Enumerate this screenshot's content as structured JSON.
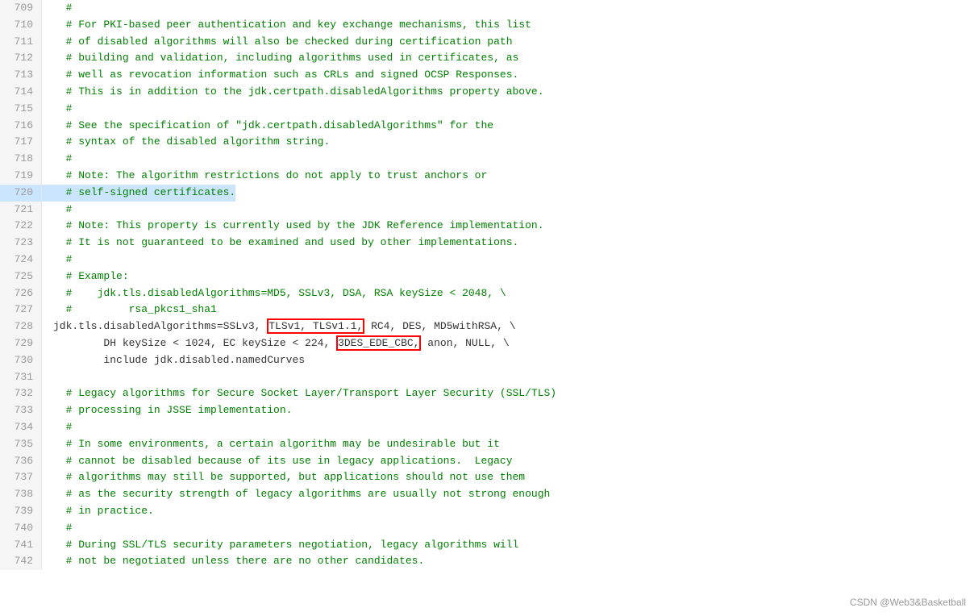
{
  "editor": {
    "background": "#ffffff",
    "lines": [
      {
        "num": 709,
        "text": "  #",
        "comment": true,
        "highlight": false
      },
      {
        "num": 710,
        "text": "  # For PKI-based peer authentication and key exchange mechanisms, this list",
        "comment": true,
        "highlight": false
      },
      {
        "num": 711,
        "text": "  # of disabled algorithms will also be checked during certification path",
        "comment": true,
        "highlight": false
      },
      {
        "num": 712,
        "text": "  # building and validation, including algorithms used in certificates, as",
        "comment": true,
        "highlight": false
      },
      {
        "num": 713,
        "text": "  # well as revocation information such as CRLs and signed OCSP Responses.",
        "comment": true,
        "highlight": false
      },
      {
        "num": 714,
        "text": "  # This is in addition to the jdk.certpath.disabledAlgorithms property above.",
        "comment": true,
        "highlight": false
      },
      {
        "num": 715,
        "text": "  #",
        "comment": true,
        "highlight": false
      },
      {
        "num": 716,
        "text": "  # See the specification of \"jdk.certpath.disabledAlgorithms\" for the",
        "comment": true,
        "highlight": false
      },
      {
        "num": 717,
        "text": "  # syntax of the disabled algorithm string.",
        "comment": true,
        "highlight": false
      },
      {
        "num": 718,
        "text": "  #",
        "comment": true,
        "highlight": false
      },
      {
        "num": 719,
        "text": "  # Note: The algorithm restrictions do not apply to trust anchors or",
        "comment": true,
        "highlight": false
      },
      {
        "num": 720,
        "text": "  # self-signed certificates.",
        "comment": true,
        "highlight": true
      },
      {
        "num": 721,
        "text": "  #",
        "comment": true,
        "highlight": false
      },
      {
        "num": 722,
        "text": "  # Note: This property is currently used by the JDK Reference implementation.",
        "comment": true,
        "highlight": false
      },
      {
        "num": 723,
        "text": "  # It is not guaranteed to be examined and used by other implementations.",
        "comment": true,
        "highlight": false
      },
      {
        "num": 724,
        "text": "  #",
        "comment": true,
        "highlight": false
      },
      {
        "num": 725,
        "text": "  # Example:",
        "comment": true,
        "highlight": false
      },
      {
        "num": 726,
        "text": "  #    jdk.tls.disabledAlgorithms=MD5, SSLv3, DSA, RSA keySize < 2048, \\",
        "comment": true,
        "highlight": false
      },
      {
        "num": 727,
        "text": "  #         rsa_pkcs1_sha1",
        "comment": true,
        "highlight": false
      },
      {
        "num": 728,
        "text": "jdk.tls.disabledAlgorithms=SSLv3, TLSv1, TLSv1.1, RC4, DES, MD5withRSA, \\",
        "comment": false,
        "highlight": false,
        "special728": true
      },
      {
        "num": 729,
        "text": "        DH keySize < 1024, EC keySize < 224, 3DES_EDE_CBC, anon, NULL, \\",
        "comment": false,
        "highlight": false,
        "special729": true
      },
      {
        "num": 730,
        "text": "        include jdk.disabled.namedCurves",
        "comment": false,
        "highlight": false
      },
      {
        "num": 731,
        "text": "",
        "comment": false,
        "highlight": false
      },
      {
        "num": 732,
        "text": "  # Legacy algorithms for Secure Socket Layer/Transport Layer Security (SSL/TLS)",
        "comment": true,
        "highlight": false
      },
      {
        "num": 733,
        "text": "  # processing in JSSE implementation.",
        "comment": true,
        "highlight": false
      },
      {
        "num": 734,
        "text": "  #",
        "comment": true,
        "highlight": false
      },
      {
        "num": 735,
        "text": "  # In some environments, a certain algorithm may be undesirable but it",
        "comment": true,
        "highlight": false
      },
      {
        "num": 736,
        "text": "  # cannot be disabled because of its use in legacy applications.  Legacy",
        "comment": true,
        "highlight": false
      },
      {
        "num": 737,
        "text": "  # algorithms may still be supported, but applications should not use them",
        "comment": true,
        "highlight": false
      },
      {
        "num": 738,
        "text": "  # as the security strength of legacy algorithms are usually not strong enough",
        "comment": true,
        "highlight": false
      },
      {
        "num": 739,
        "text": "  # in practice.",
        "comment": true,
        "highlight": false
      },
      {
        "num": 740,
        "text": "  #",
        "comment": true,
        "highlight": false
      },
      {
        "num": 741,
        "text": "  # During SSL/TLS security parameters negotiation, legacy algorithms will",
        "comment": true,
        "highlight": false
      },
      {
        "num": 742,
        "text": "  # not be negotiated unless there are no other candidates.",
        "comment": true,
        "highlight": false
      }
    ]
  },
  "watermark": "CSDN @Web3&Basketball"
}
